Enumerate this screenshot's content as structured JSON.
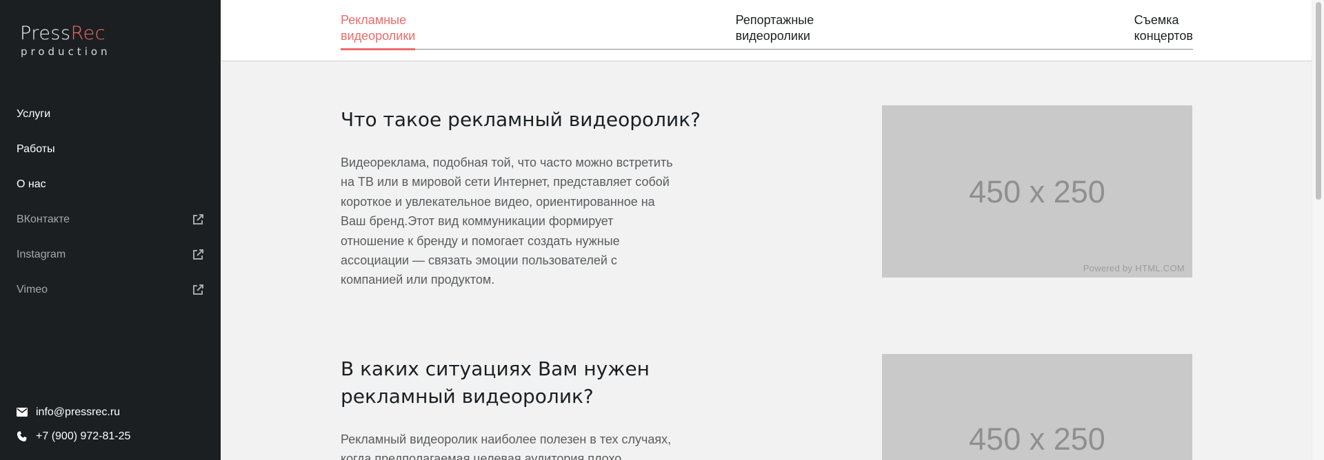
{
  "brand": {
    "name_part1": "Press",
    "name_part2": "Rec",
    "subtitle": "production",
    "accent_color": "#ef6a6a"
  },
  "sidebar": {
    "nav": [
      {
        "label": "Услуги"
      },
      {
        "label": "Работы"
      },
      {
        "label": "О нас"
      }
    ],
    "social": [
      {
        "label": "ВКонтакте",
        "icon": "external-link-icon"
      },
      {
        "label": "Instagram",
        "icon": "external-link-icon"
      },
      {
        "label": "Vimeo",
        "icon": "external-link-icon"
      }
    ],
    "contacts": {
      "email": "info@pressrec.ru",
      "phone": "+7 (900) 972-81-25"
    }
  },
  "tabs": [
    {
      "line1": "Рекламные",
      "line2": "видеоролики",
      "active": true
    },
    {
      "line1": "Репортажные",
      "line2": "видеоролики",
      "active": false
    },
    {
      "line1": "Съемка",
      "line2": "концертов",
      "active": false
    }
  ],
  "sections": [
    {
      "title": "Что такое рекламный видеоролик?",
      "text_lines": [
        "Видеореклама, подобная той, что часто можно встретить",
        "на ТВ или в мировой сети Интернет, представляет собой",
        "короткое и увлекательное видео, ориентированное на",
        "Ваш бренд.Этот вид коммуникации формирует",
        "отношение к бренду и помогает создать нужные",
        "ассоциации — связать эмоции пользователей с",
        "компанией или продуктом."
      ],
      "image": {
        "label": "450 x 250",
        "powered": "Powered by HTML.COM"
      }
    },
    {
      "title_lines": [
        "В каких ситуациях Вам нужен",
        "рекламный видеоролик?"
      ],
      "text_lines": [
        "Рекламный видеоролик наиболее полезен в тех случаях,",
        "когда предполагаемая целевая аудитория плохо"
      ],
      "image": {
        "label": "450 x 250"
      }
    }
  ]
}
